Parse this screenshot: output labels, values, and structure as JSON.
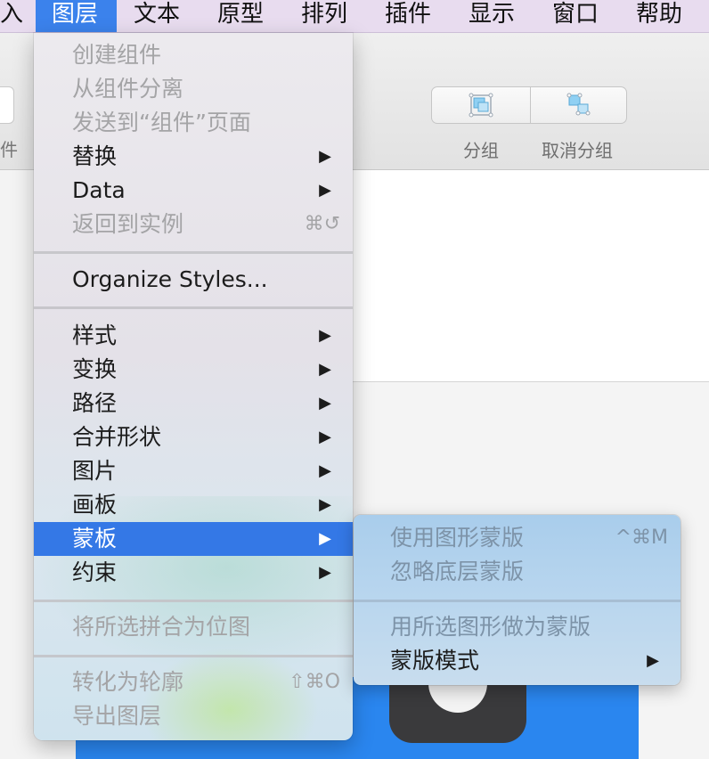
{
  "menubar": {
    "items": [
      "入",
      "图层",
      "文本",
      "原型",
      "排列",
      "插件",
      "显示",
      "窗口",
      "帮助"
    ],
    "active_index": 1
  },
  "toolbar": {
    "left_label": "件",
    "group_label": "分组",
    "ungroup_label": "取消分组"
  },
  "menu": {
    "items": [
      {
        "label": "创建组件",
        "disabled": true
      },
      {
        "label": "从组件分离",
        "disabled": true
      },
      {
        "label": "发送到“组件”页面",
        "disabled": true
      },
      {
        "label": "替换",
        "submenu": true
      },
      {
        "label": "Data",
        "submenu": true
      },
      {
        "label": "返回到实例",
        "disabled": true,
        "shortcut": "⌘↺"
      },
      {
        "label": "Organize Styles..."
      },
      {
        "label": "样式",
        "submenu": true
      },
      {
        "label": "变换",
        "submenu": true
      },
      {
        "label": "路径",
        "submenu": true
      },
      {
        "label": "合并形状",
        "submenu": true
      },
      {
        "label": "图片",
        "submenu": true
      },
      {
        "label": "画板",
        "submenu": true
      },
      {
        "label": "蒙板",
        "submenu": true,
        "highlighted": true
      },
      {
        "label": "约束",
        "submenu": true
      },
      {
        "label": "将所选拼合为位图",
        "disabled": true
      },
      {
        "label": "转化为轮廓",
        "disabled": true,
        "shortcut": "⇧⌘O"
      },
      {
        "label": "导出图层",
        "disabled": true
      }
    ],
    "arrow": "▶"
  },
  "submenu": {
    "items": [
      {
        "label": "使用图形蒙版",
        "disabled": true,
        "shortcut": "^⌘M"
      },
      {
        "label": "忽略底层蒙版",
        "disabled": true
      },
      {
        "label": "用所选图形做为蒙版",
        "disabled": true
      },
      {
        "label": "蒙版模式",
        "submenu": true
      }
    ]
  },
  "colors": {
    "highlight": "#3478e6",
    "menubar_active": "#3b82ec",
    "menubar_bg": "#e8dcef",
    "canvas_blue": "#2a86ef"
  },
  "icons": {
    "group": "group-icon",
    "ungroup": "ungroup-icon",
    "submenu_arrow": "triangle-right-icon"
  }
}
